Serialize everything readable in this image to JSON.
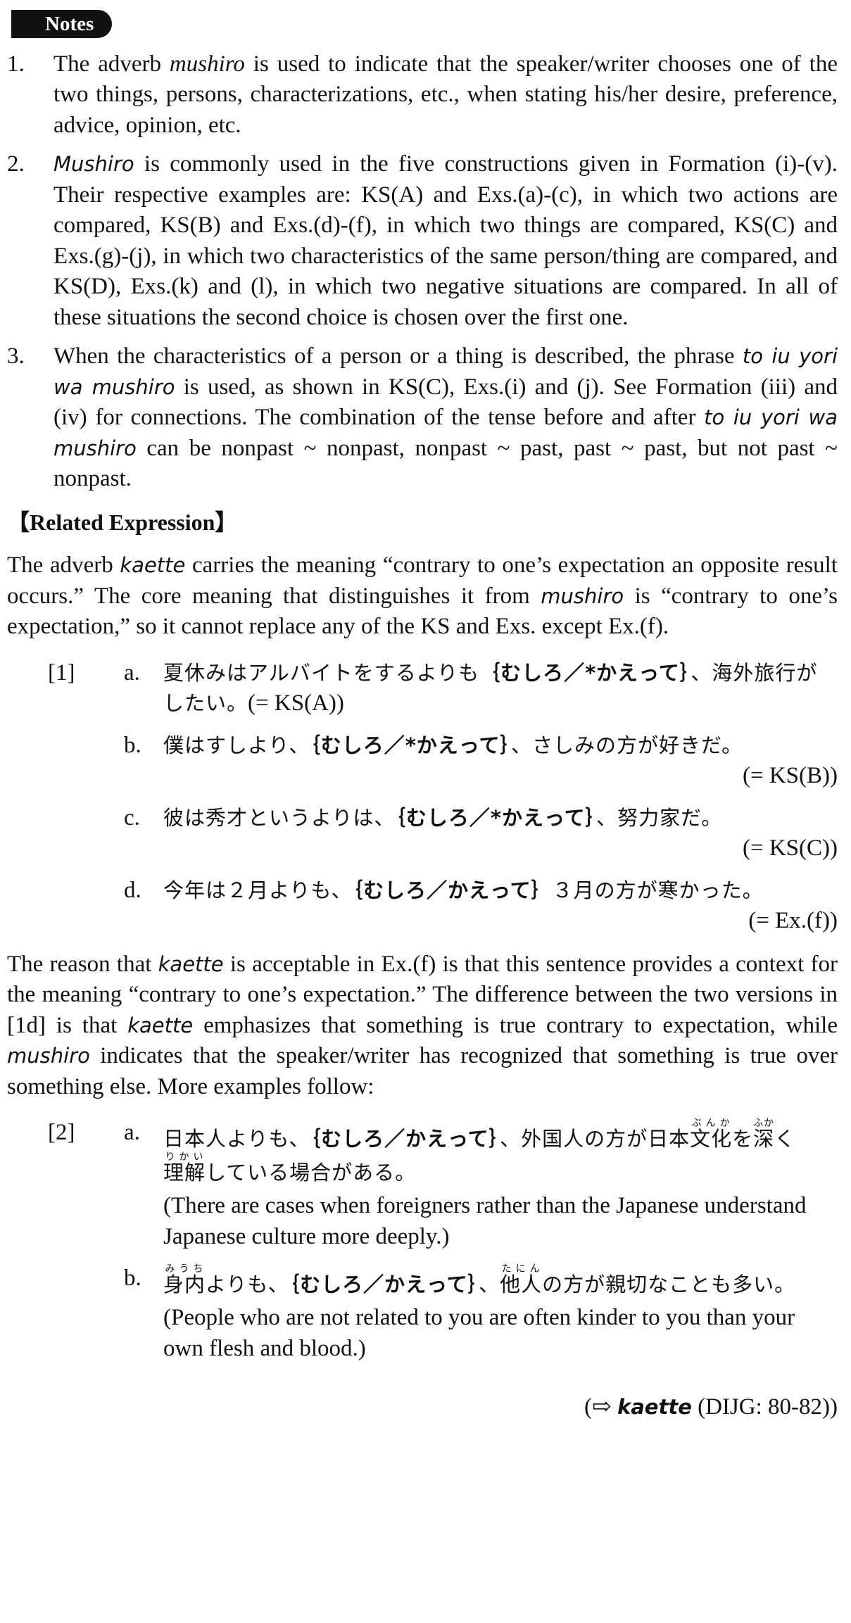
{
  "header": {
    "notes_label": "Notes"
  },
  "notes": [
    {
      "num": "1.",
      "pre": "The adverb ",
      "term": "mushiro",
      "post": " is used to indicate that the speaker/writer chooses one of the two things, persons, characterizations, etc., when stating his/her desire, preference, advice, opinion, etc."
    },
    {
      "num": "2.",
      "term": "Mushiro",
      "post": " is commonly used in the five constructions given in Formation (i)-(v). Their respective examples are: KS(A) and Exs.(a)-(c), in which two actions are compared, KS(B) and Exs.(d)-(f), in which two things are compared, KS(C) and Exs.(g)-(j), in which two characteristics of the same person/thing are compared, and KS(D), Exs.(k) and (l), in which two negative situations are compared. In all of these situations the second choice is chosen over the first one."
    },
    {
      "num": "3.",
      "pre": "When the characteristics of a person or a thing is described, the phrase ",
      "term": "to iu yori wa mushiro",
      "mid": " is used, as shown in KS(C), Exs.(i) and (j). See Formation (iii) and (iv) for connections. The combination of the tense before and after ",
      "term2": "to iu yori wa mushiro",
      "post": " can be nonpast ~ nonpast, nonpast ~ past, past ~ past, but not past ~ nonpast."
    }
  ],
  "related": {
    "heading": "【Related Expression】",
    "p1_a": "The adverb ",
    "p1_term": "kaette",
    "p1_b": " carries the meaning “contrary to one’s expectation an opposite result occurs.” The core meaning that distinguishes it from ",
    "p1_term2": "mushiro",
    "p1_c": " is “contrary to one’s expectation,” so it cannot replace any of the KS and Exs. except Ex.(f)."
  },
  "ex1": {
    "tag": "[1]",
    "items": [
      {
        "sub": "a.",
        "pre": "夏休みはアルバイトをするよりも",
        "choice": "｛むしろ／*かえって｝",
        "post": "、海外旅行がしたい。",
        "ref": "(= KS(A))"
      },
      {
        "sub": "b.",
        "pre": "僕はすしより、",
        "choice": "｛むしろ／*かえって｝",
        "post": "、さしみの方が好きだ。",
        "ref": "(= KS(B))"
      },
      {
        "sub": "c.",
        "pre": "彼は秀才というよりは、",
        "choice": "｛むしろ／*かえって｝",
        "post": "、努力家だ。",
        "ref": "(= KS(C))"
      },
      {
        "sub": "d.",
        "pre": "今年は２月よりも、",
        "choice": "｛むしろ／かえって｝",
        "post": "３月の方が寒かった。",
        "ref": "(= Ex.(f))"
      }
    ]
  },
  "para2": {
    "a": "The reason that ",
    "term": "kaette",
    "b": " is acceptable in Ex.(f) is that this sentence provides a context for the meaning “contrary to one’s expectation.” The difference between the two versions in [1d] is that ",
    "term2": "kaette",
    "c": " emphasizes that something is true contrary to expectation, while ",
    "term3": "mushiro",
    "d": " indicates that the speaker/writer has recognized that something is true over something else. More examples follow:"
  },
  "ex2": {
    "tag": "[2]",
    "a": {
      "sub": "a.",
      "pre": "日本人よりも、",
      "choice": "｛むしろ／かえって｝",
      "mid": "、外国人の方が日本",
      "bunka": "文化",
      "bunka_rt": "ぶんか",
      "wo": "を",
      "fuka": "深",
      "fuka_rt": "ふか",
      "ku": "く",
      "rikai": "理解",
      "rikai_rt": "りかい",
      "end": "している場合がある。",
      "trans": "(There are cases when foreigners rather than the Japanese understand Japanese culture more deeply.)"
    },
    "b": {
      "sub": "b.",
      "miuchi": "身内",
      "miuchi_rt": "みうち",
      "pre": "よりも、",
      "choice": "｛むしろ／かえって｝",
      "mid": "、",
      "tanin": "他人",
      "tanin_rt": "たにん",
      "end": "の方が親切なことも多い。",
      "trans": "(People who are not related to you are often kinder to you than your own flesh and blood.)"
    }
  },
  "footer_ref": {
    "open": "(",
    "arrow": "⇨",
    "term": "kaette",
    "rest": " (DIJG: 80-82))"
  }
}
